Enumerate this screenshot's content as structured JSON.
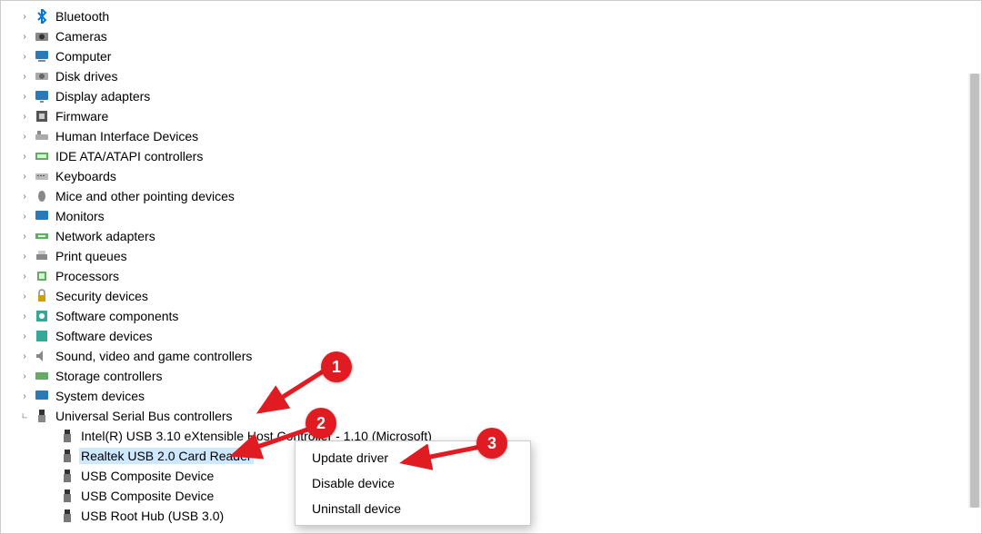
{
  "tree": {
    "items": [
      {
        "label": "Bluetooth",
        "icon": "bluetooth"
      },
      {
        "label": "Cameras",
        "icon": "camera"
      },
      {
        "label": "Computer",
        "icon": "computer"
      },
      {
        "label": "Disk drives",
        "icon": "disk"
      },
      {
        "label": "Display adapters",
        "icon": "display"
      },
      {
        "label": "Firmware",
        "icon": "firmware"
      },
      {
        "label": "Human Interface Devices",
        "icon": "hid"
      },
      {
        "label": "IDE ATA/ATAPI controllers",
        "icon": "ide"
      },
      {
        "label": "Keyboards",
        "icon": "keyboard"
      },
      {
        "label": "Mice and other pointing devices",
        "icon": "mouse"
      },
      {
        "label": "Monitors",
        "icon": "monitor"
      },
      {
        "label": "Network adapters",
        "icon": "network"
      },
      {
        "label": "Print queues",
        "icon": "printer"
      },
      {
        "label": "Processors",
        "icon": "cpu"
      },
      {
        "label": "Security devices",
        "icon": "security"
      },
      {
        "label": "Software components",
        "icon": "component"
      },
      {
        "label": "Software devices",
        "icon": "softdev"
      },
      {
        "label": "Sound, video and game controllers",
        "icon": "sound"
      },
      {
        "label": "Storage controllers",
        "icon": "storage"
      },
      {
        "label": "System devices",
        "icon": "system"
      }
    ],
    "expanded": {
      "label": "Universal Serial Bus controllers",
      "children": [
        {
          "label": "Intel(R) USB 3.10 eXtensible Host Controller - 1.10 (Microsoft)"
        },
        {
          "label": "Realtek USB 2.0 Card Reader",
          "selected": true
        },
        {
          "label": "USB Composite Device"
        },
        {
          "label": "USB Composite Device"
        },
        {
          "label": "USB Root Hub (USB 3.0)"
        }
      ]
    }
  },
  "context_menu": {
    "items": [
      {
        "label": "Update driver"
      },
      {
        "label": "Disable device"
      },
      {
        "label": "Uninstall device"
      }
    ]
  },
  "callouts": {
    "one": "1",
    "two": "2",
    "three": "3"
  }
}
